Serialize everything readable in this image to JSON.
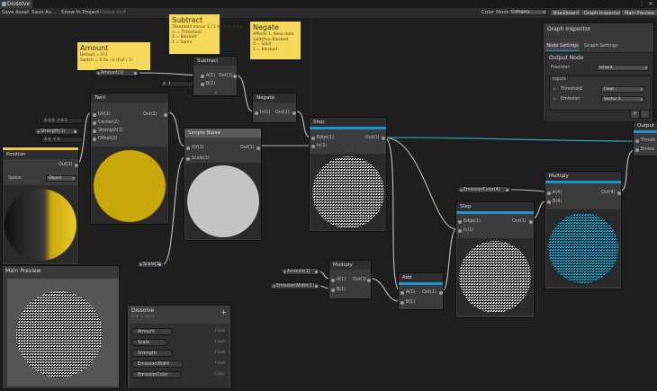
{
  "window": {
    "tab_title": "Dissolve"
  },
  "toolbar": {
    "save_asset": "Save Asset",
    "save_as": "Save As...",
    "show_in_project": "Show In Project",
    "check_out": "Check Out",
    "color_mode_label": "Color Mode",
    "color_mode_value": "Category",
    "blackboard": "Blackboard",
    "graph_inspector": "Graph Inspector",
    "main_preview": "Main Preview"
  },
  "stickies": {
    "subtract": {
      "title": "Subtract",
      "body": "Threshold minus 1 / 1 hard to keep ... \n> = Threshold ... \n1 = Blocked\n1 = Same"
    },
    "negate": {
      "title": "Negate",
      "body": "Affects 1, Keep data\nSwitches Blocked\n0 = Solid\n1 = Blocked"
    },
    "amount": {
      "title": "Amount",
      "body": "Default = 0.5\nSwitch = 0.0n / 0 (Full / 1)"
    }
  },
  "nodes": {
    "subtract": {
      "title": "Subtract",
      "in_a": "A(1)",
      "in_b": "B(1)",
      "out": "Out(1)",
      "b_value": "1"
    },
    "negate": {
      "title": "Negate",
      "in": "In(1)",
      "out": "Out(1)"
    },
    "twirl": {
      "title": "Twirl",
      "in_uv": "UV(2)",
      "in_center": "Center(2)",
      "in_strength": "Strength(1)",
      "in_offset": "Offset(2)",
      "out": "Out(2)",
      "center_x": "0.5",
      "center_y": "0.5",
      "offset_x": "0",
      "offset_y": "0"
    },
    "simple_noise": {
      "title": "Simple Noise",
      "in_uv": "UV(2)",
      "in_scale": "Scale(1)",
      "out": "Out(1)"
    },
    "step": {
      "title": "Step",
      "in_edge": "Edge(1)",
      "in_in": "In(1)",
      "out": "Out(1)"
    },
    "position": {
      "title": "Position",
      "out": "Out(3)",
      "space_label": "Space",
      "space_value": "Object"
    },
    "step2": {
      "title": "Step",
      "in_edge": "Edge(1)",
      "in_in": "In(1)",
      "out": "Out(1)"
    },
    "multiply": {
      "title": "Multiply",
      "in_a": "A(1)",
      "in_b": "B(1)",
      "out": "Out(1)"
    },
    "multiply2": {
      "title": "Multiply",
      "in_a": "A(4)",
      "in_b": "B(4)",
      "out": "Out(4)"
    },
    "add": {
      "title": "Add",
      "in_a": "A(1)",
      "in_b": "B(1)",
      "out": "Out(1)"
    },
    "output": {
      "title": "Output",
      "in1": "Thresh",
      "in2": "Emissi"
    }
  },
  "pills": {
    "amount": "Amount(1)",
    "strength": "Strength(1)",
    "scale": "Scale(1)",
    "emission_color": "EmissionColor(4)",
    "amount2": "Amount(1)",
    "emission_width": "EmissionWidth(1)"
  },
  "inspector": {
    "title": "Graph Inspector",
    "tab_node": "Node Settings",
    "tab_graph": "Graph Settings",
    "section": "Output Node",
    "precision_label": "Precision",
    "precision_value": "Inherit",
    "inputs_label": "Inputs",
    "rows": [
      {
        "name": "Threshold",
        "type": "Float"
      },
      {
        "name": "Emission",
        "type": "Vector 3"
      }
    ],
    "add_btn": "+",
    "remove_btn": "-"
  },
  "main_preview": {
    "title": "Main Preview"
  },
  "blackboard": {
    "title": "Dissolve",
    "subtitle": "Sub Graphs",
    "add": "+",
    "properties": [
      {
        "name": "Amount",
        "type": "Float"
      },
      {
        "name": "Scale",
        "type": "Float"
      },
      {
        "name": "Strength",
        "type": "Float"
      },
      {
        "name": "EmissionWidth",
        "type": "Float"
      },
      {
        "name": "EmissionColor",
        "type": "Color"
      }
    ]
  },
  "colors": {
    "accent": "#1c94cc",
    "sticky": "#f6d85a",
    "canvas": "#1e1e1e",
    "node": "#3b3b3b",
    "twirl_preview": "#c9a80b",
    "multiply_preview": "#2ab2d6"
  }
}
